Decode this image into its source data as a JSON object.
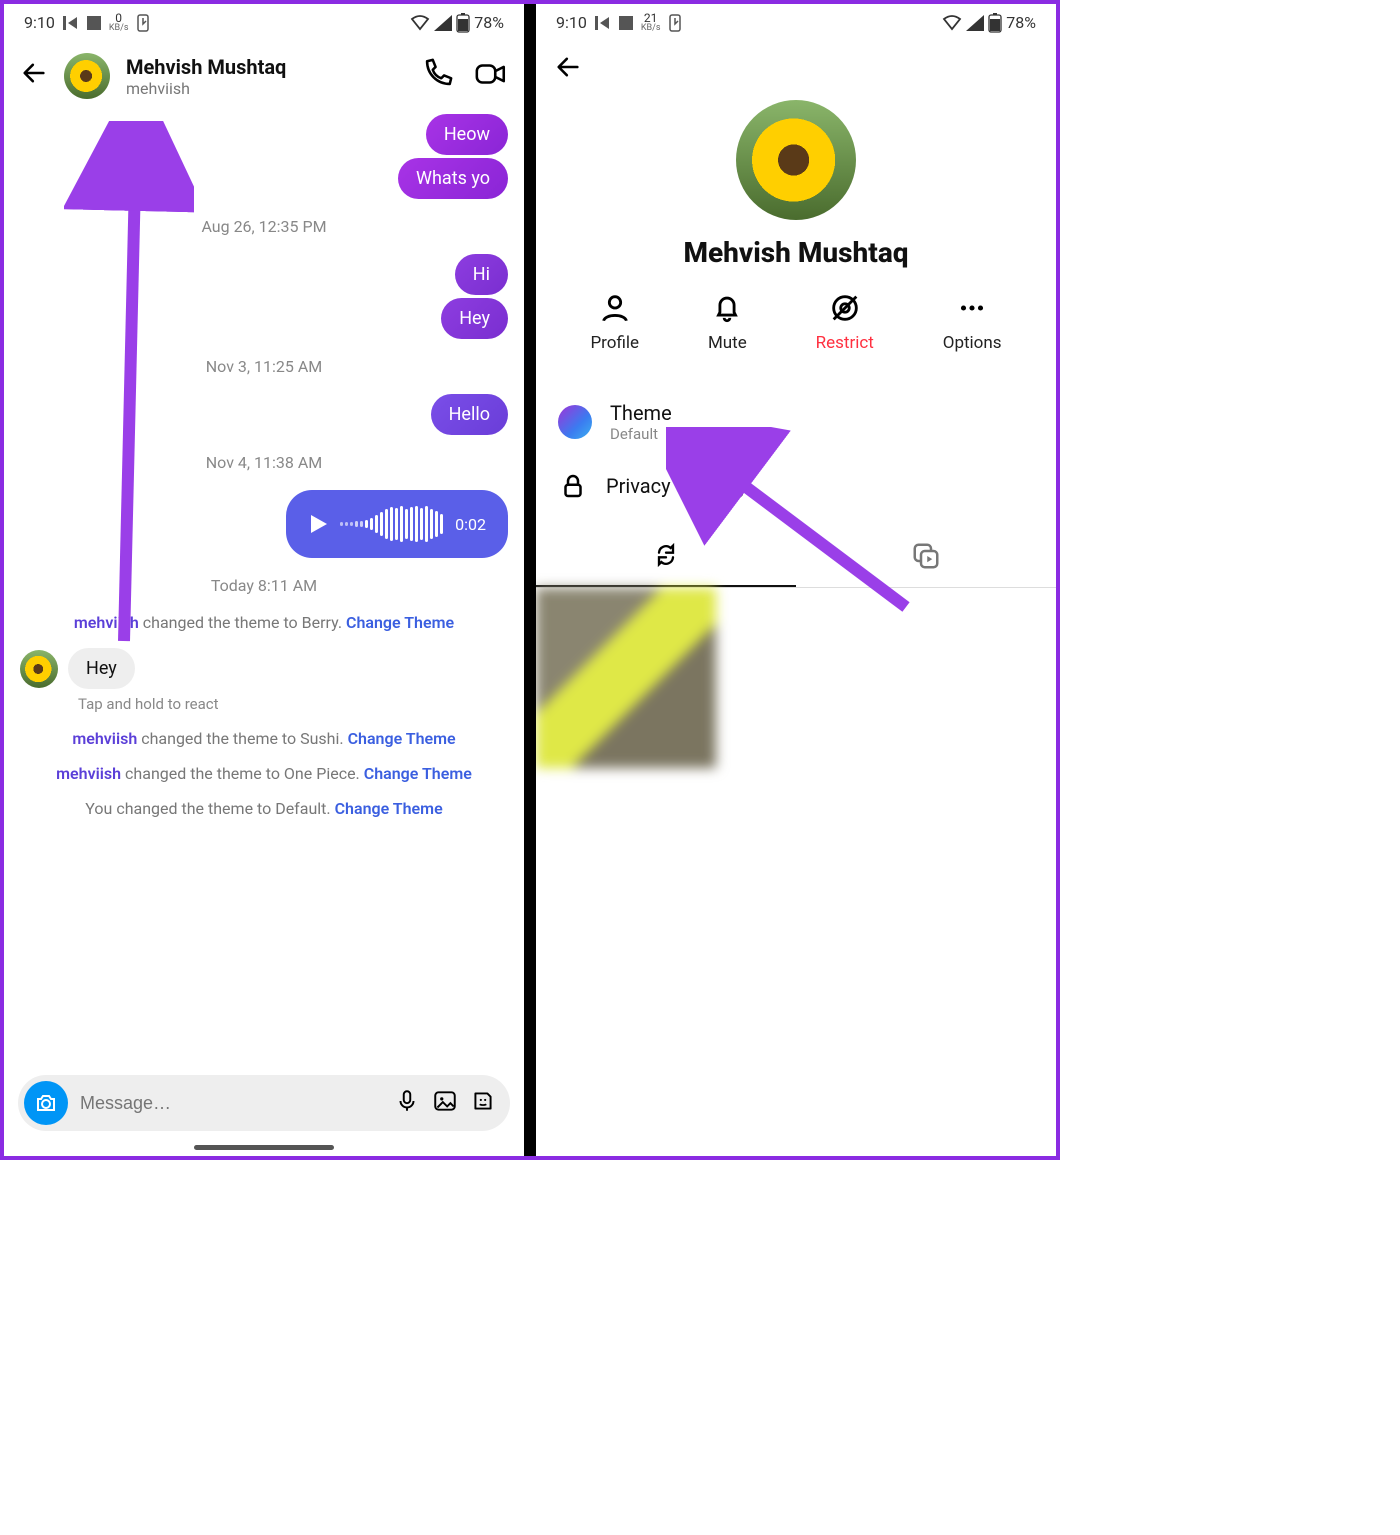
{
  "status": {
    "time": "9:10",
    "kbps_left": "0",
    "kbps_right": "21",
    "kbps_unit": "KB/s",
    "battery": "78%"
  },
  "chat": {
    "contact_name": "Mehvish Mushtaq",
    "contact_username": "mehviish",
    "messages": {
      "m1": "Heow",
      "m2": "Whats yo",
      "ts1": "Aug 26, 12:35 PM",
      "m3": "Hi",
      "m4": "Hey",
      "ts2": "Nov 3, 11:25 AM",
      "m5": "Hello",
      "ts3": "Nov 4, 11:38 AM",
      "voice_duration": "0:02",
      "ts4": "Today 8:11 AM",
      "system1_who": "mehviish",
      "system1_text": " changed the theme to Berry. ",
      "system1_link": "Change Theme",
      "in1": "Hey",
      "hint": "Tap and hold to react",
      "system2_who": "mehviish",
      "system2_text": " changed the theme to Sushi. ",
      "system2_link": "Change Theme",
      "system3_who": "mehviish",
      "system3_text": " changed the theme to One Piece. ",
      "system3_link": "Change Theme",
      "system4_text": "You changed the theme to Default. ",
      "system4_link": "Change Theme"
    },
    "compose_placeholder": "Message…"
  },
  "profile": {
    "name": "Mehvish Mushtaq",
    "actions": {
      "profile": "Profile",
      "mute": "Mute",
      "restrict": "Restrict",
      "options": "Options"
    },
    "theme_label": "Theme",
    "theme_value": "Default",
    "privacy_label": "Privacy & safety"
  }
}
